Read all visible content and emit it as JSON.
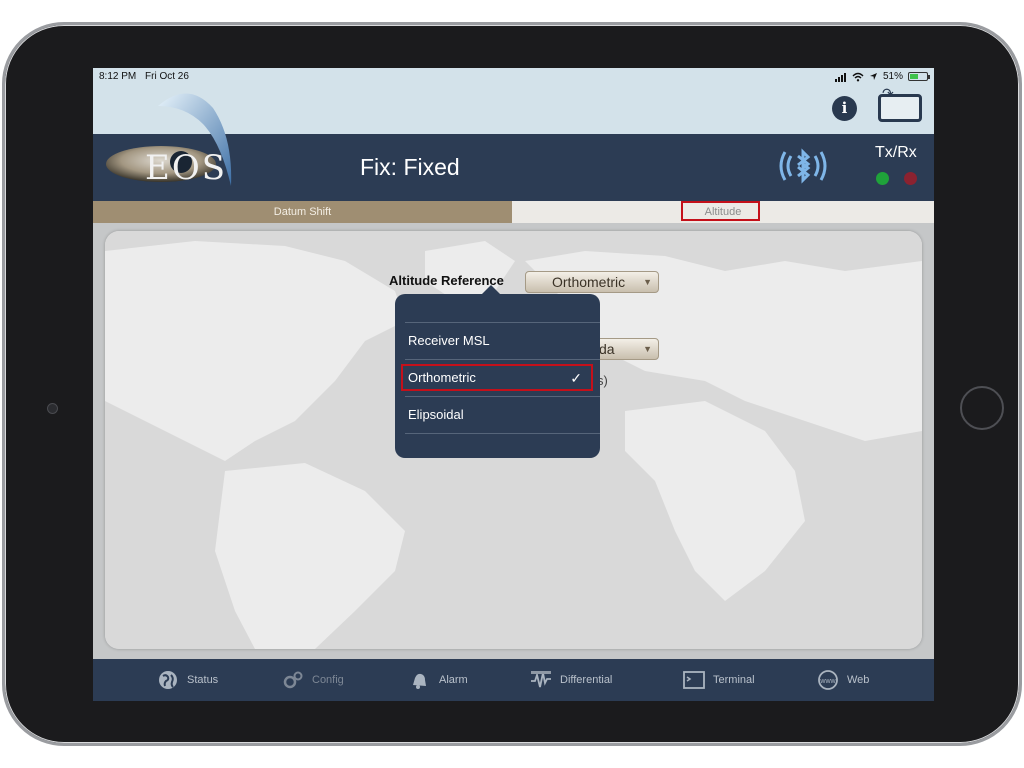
{
  "status_bar": {
    "time": "8:12 PM",
    "date": "Fri Oct 26",
    "battery": "51%",
    "battery_level": 0.51
  },
  "header": {
    "logo_text": "EOS",
    "fix_status": "Fix: Fixed",
    "txrx_label": "Tx/Rx",
    "tx_color": "#1fa23a",
    "rx_color": "#8b2230",
    "bluetooth_icon": "bluetooth-icon",
    "info_icon": "info-icon",
    "rotate_icon": "rotate-tablet-icon"
  },
  "tabs": [
    {
      "label": "Datum Shift"
    },
    {
      "label": "Altitude"
    }
  ],
  "main": {
    "altitude_reference_label": "Altitude Reference",
    "altitude_reference_value": "Orthometric",
    "hidden_field_partial": "da",
    "hidden_text_partial": "s)",
    "dropdown_options": [
      {
        "label": "Receiver MSL",
        "selected": false
      },
      {
        "label": "Orthometric",
        "selected": true
      },
      {
        "label": "Elipsoidal",
        "selected": false
      }
    ],
    "check_glyph": "✓"
  },
  "bottom_nav": [
    {
      "label": "Status",
      "icon": "globe-icon"
    },
    {
      "label": "Config",
      "icon": "gears-icon"
    },
    {
      "label": "Alarm",
      "icon": "alarm-icon"
    },
    {
      "label": "Differential",
      "icon": "signal-icon"
    },
    {
      "label": "Terminal",
      "icon": "terminal-icon"
    },
    {
      "label": "Web",
      "icon": "web-icon"
    }
  ],
  "colors": {
    "accent_navy": "#2c3c54",
    "highlight_red": "#c4101a",
    "tab_active_tan": "#9f8e72"
  }
}
